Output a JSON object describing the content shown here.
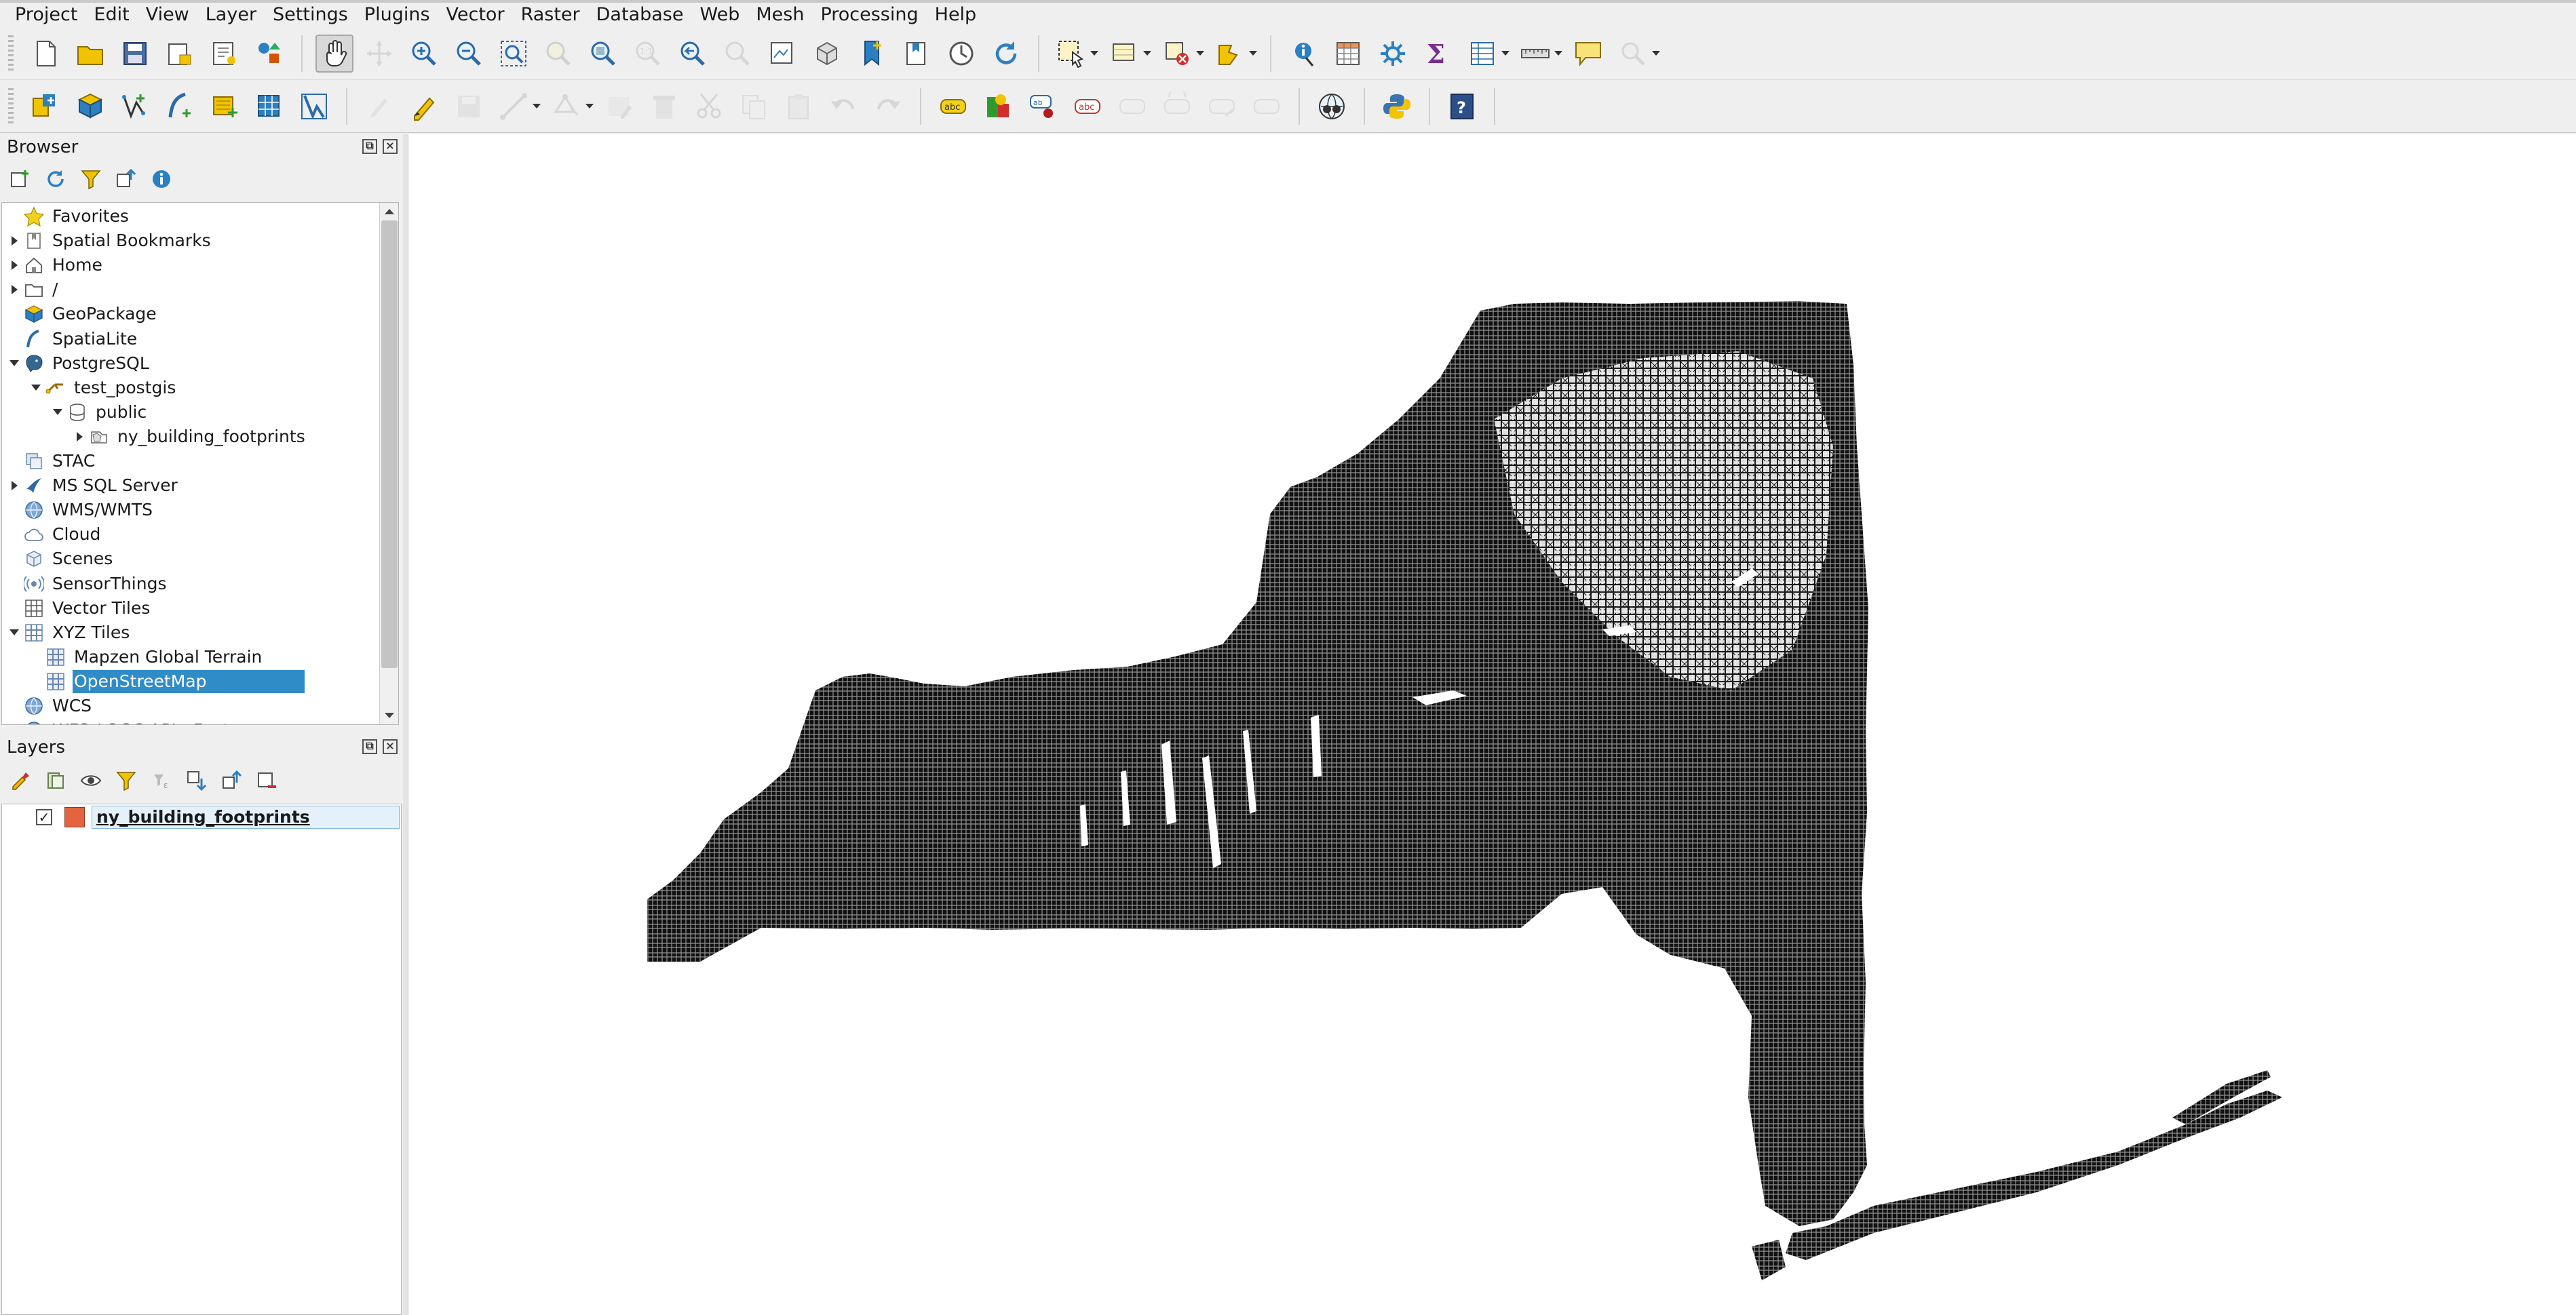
{
  "menu": [
    {
      "label": "Project",
      "name": "menu-project"
    },
    {
      "label": "Edit",
      "name": "menu-edit"
    },
    {
      "label": "View",
      "name": "menu-view"
    },
    {
      "label": "Layer",
      "name": "menu-layer"
    },
    {
      "label": "Settings",
      "name": "menu-settings"
    },
    {
      "label": "Plugins",
      "name": "menu-plugins"
    },
    {
      "label": "Vector",
      "name": "menu-vector"
    },
    {
      "label": "Raster",
      "name": "menu-raster"
    },
    {
      "label": "Database",
      "name": "menu-database"
    },
    {
      "label": "Web",
      "name": "menu-web"
    },
    {
      "label": "Mesh",
      "name": "menu-mesh"
    },
    {
      "label": "Processing",
      "name": "menu-processing"
    },
    {
      "label": "Help",
      "name": "menu-help"
    }
  ],
  "toolbar1_icons": [
    "new-project-icon",
    "open-project-icon",
    "save-project-icon",
    "print-layout-icon",
    "layout-manager-icon",
    "style-manager-icon",
    "pan-icon",
    "pan-to-selection-icon",
    "zoom-in-icon",
    "zoom-out-icon",
    "zoom-full-icon",
    "zoom-to-selection-icon",
    "zoom-to-layer-icon",
    "zoom-native-icon",
    "zoom-last-icon",
    "zoom-next-icon",
    "new-map-view-icon",
    "new-3d-map-view-icon",
    "new-bookmark-icon",
    "show-bookmarks-icon",
    "temporal-controller-icon",
    "refresh-icon",
    "select-features-icon",
    "select-by-value-icon",
    "deselect-icon",
    "select-by-location-icon",
    "identify-icon",
    "open-attribute-table-icon",
    "processing-toolbox-icon",
    "statistics-icon",
    "attribute-table-icon",
    "measure-icon",
    "map-tips-icon",
    "locator-icon"
  ],
  "toolbar2_icons": [
    "data-source-manager-icon",
    "new-geopackage-layer-icon",
    "digitize-vector-icon",
    "new-spatialite-icon",
    "new-temporary-layer-icon",
    "new-virtual-layer-icon",
    "georeferencer-icon",
    "current-edits-icon",
    "toggle-editing-icon",
    "save-edits-icon",
    "digitize-with-segment-icon",
    "vertex-tool-icon",
    "modify-attributes-icon",
    "delete-selected-icon",
    "cut-features-icon",
    "copy-features-icon",
    "paste-features-icon",
    "undo-icon",
    "redo-icon",
    "label-tool-icon",
    "diagram-tool-icon",
    "pin-labels-icon",
    "show-hide-labels-icon",
    "move-label-icon",
    "rotate-label-icon",
    "change-label-icon",
    "label-toolbar-icon",
    "grass-icon",
    "python-console-icon",
    "help-icon"
  ],
  "browser": {
    "title": "Browser",
    "items": [
      {
        "label": "Favorites",
        "icon": "star-icon",
        "arrow": "none",
        "indent": 0
      },
      {
        "label": "Spatial Bookmarks",
        "icon": "bookmark-icon",
        "arrow": "collapsed",
        "indent": 0
      },
      {
        "label": "Home",
        "icon": "home-icon",
        "arrow": "collapsed",
        "indent": 0
      },
      {
        "label": "/",
        "icon": "folder-icon",
        "arrow": "collapsed",
        "indent": 0
      },
      {
        "label": "GeoPackage",
        "icon": "geopackage-icon",
        "arrow": "none",
        "indent": 0
      },
      {
        "label": "SpatiaLite",
        "icon": "spatialite-icon",
        "arrow": "none",
        "indent": 0
      },
      {
        "label": "PostgreSQL",
        "icon": "postgresql-icon",
        "arrow": "expanded",
        "indent": 0
      },
      {
        "label": "test_postgis",
        "icon": "connection-icon",
        "arrow": "expanded",
        "indent": 1
      },
      {
        "label": "public",
        "icon": "schema-icon",
        "arrow": "expanded",
        "indent": 2
      },
      {
        "label": "ny_building_footprints",
        "icon": "polygon-layer-icon",
        "arrow": "collapsed",
        "indent": 3
      },
      {
        "label": "STAC",
        "icon": "stac-icon",
        "arrow": "none",
        "indent": 0
      },
      {
        "label": "MS SQL Server",
        "icon": "mssql-icon",
        "arrow": "collapsed",
        "indent": 0
      },
      {
        "label": "WMS/WMTS",
        "icon": "wms-icon",
        "arrow": "none",
        "indent": 0
      },
      {
        "label": "Cloud",
        "icon": "cloud-icon",
        "arrow": "none",
        "indent": 0
      },
      {
        "label": "Scenes",
        "icon": "scenes-icon",
        "arrow": "none",
        "indent": 0
      },
      {
        "label": "SensorThings",
        "icon": "sensorthings-icon",
        "arrow": "none",
        "indent": 0
      },
      {
        "label": "Vector Tiles",
        "icon": "vector-tiles-icon",
        "arrow": "none",
        "indent": 0
      },
      {
        "label": "XYZ Tiles",
        "icon": "xyz-tiles-icon",
        "arrow": "expanded",
        "indent": 0
      },
      {
        "label": "Mapzen Global Terrain",
        "icon": "xyz-layer-icon",
        "arrow": "none",
        "indent": 1
      },
      {
        "label": "OpenStreetMap",
        "icon": "xyz-layer-icon",
        "arrow": "none",
        "indent": 1,
        "selected": true
      },
      {
        "label": "WCS",
        "icon": "wcs-icon",
        "arrow": "none",
        "indent": 0
      },
      {
        "label": "WFS / OGC API - Features",
        "icon": "wfs-icon",
        "arrow": "none",
        "indent": 0
      }
    ]
  },
  "layers": {
    "title": "Layers",
    "items": [
      {
        "label": "ny_building_footprints",
        "checked": true,
        "color": "#e4643f"
      }
    ]
  },
  "colors": {
    "accent_selected": "#308cc6",
    "layer_fill": "#e4643f",
    "map_features": "#1a1a1a"
  }
}
